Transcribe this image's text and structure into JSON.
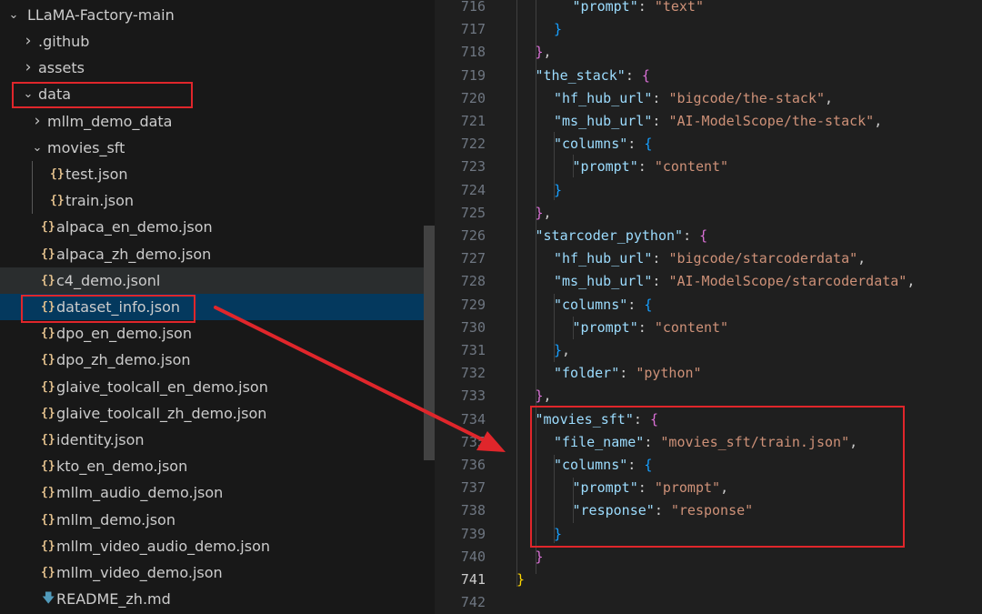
{
  "explorer": {
    "root": "LLaMA-Factory-main",
    "items": [
      {
        "label": ".github",
        "depth": 1,
        "type": "folder-collapsed"
      },
      {
        "label": "assets",
        "depth": 1,
        "type": "folder-collapsed"
      },
      {
        "label": "data",
        "depth": 1,
        "type": "folder-open"
      },
      {
        "label": "mllm_demo_data",
        "depth": 2,
        "type": "folder-collapsed"
      },
      {
        "label": "movies_sft",
        "depth": 2,
        "type": "folder-open"
      },
      {
        "label": "test.json",
        "depth": 3,
        "type": "json"
      },
      {
        "label": "train.json",
        "depth": 3,
        "type": "json"
      },
      {
        "label": "alpaca_en_demo.json",
        "depth": 2,
        "type": "json"
      },
      {
        "label": "alpaca_zh_demo.json",
        "depth": 2,
        "type": "json"
      },
      {
        "label": "c4_demo.jsonl",
        "depth": 2,
        "type": "json",
        "state": "hover"
      },
      {
        "label": "dataset_info.json",
        "depth": 2,
        "type": "json",
        "state": "selected"
      },
      {
        "label": "dpo_en_demo.json",
        "depth": 2,
        "type": "json"
      },
      {
        "label": "dpo_zh_demo.json",
        "depth": 2,
        "type": "json"
      },
      {
        "label": "glaive_toolcall_en_demo.json",
        "depth": 2,
        "type": "json"
      },
      {
        "label": "glaive_toolcall_zh_demo.json",
        "depth": 2,
        "type": "json"
      },
      {
        "label": "identity.json",
        "depth": 2,
        "type": "json"
      },
      {
        "label": "kto_en_demo.json",
        "depth": 2,
        "type": "json"
      },
      {
        "label": "mllm_audio_demo.json",
        "depth": 2,
        "type": "json"
      },
      {
        "label": "mllm_demo.json",
        "depth": 2,
        "type": "json"
      },
      {
        "label": "mllm_video_audio_demo.json",
        "depth": 2,
        "type": "json"
      },
      {
        "label": "mllm_video_demo.json",
        "depth": 2,
        "type": "json"
      },
      {
        "label": "README_zh.md",
        "depth": 2,
        "type": "markdown"
      }
    ],
    "icons": {
      "json": "{}",
      "folder_collapsed": "›",
      "folder_open": "⌄",
      "markdown": "🡇"
    }
  },
  "editor": {
    "current_line": 741,
    "lines": [
      {
        "n": 716,
        "ind": 3,
        "t": [
          [
            "k",
            "\"prompt\""
          ],
          [
            "p",
            ": "
          ],
          [
            "s",
            "\"text\""
          ]
        ]
      },
      {
        "n": 717,
        "ind": 2,
        "t": [
          [
            "b3",
            "}"
          ]
        ]
      },
      {
        "n": 718,
        "ind": 1,
        "t": [
          [
            "b2",
            "}"
          ],
          [
            "p",
            ","
          ]
        ]
      },
      {
        "n": 719,
        "ind": 1,
        "t": [
          [
            "k",
            "\"the_stack\""
          ],
          [
            "p",
            ": "
          ],
          [
            "b2",
            "{"
          ]
        ]
      },
      {
        "n": 720,
        "ind": 2,
        "t": [
          [
            "k",
            "\"hf_hub_url\""
          ],
          [
            "p",
            ": "
          ],
          [
            "s",
            "\"bigcode/the-stack\""
          ],
          [
            "p",
            ","
          ]
        ]
      },
      {
        "n": 721,
        "ind": 2,
        "t": [
          [
            "k",
            "\"ms_hub_url\""
          ],
          [
            "p",
            ": "
          ],
          [
            "s",
            "\"AI-ModelScope/the-stack\""
          ],
          [
            "p",
            ","
          ]
        ]
      },
      {
        "n": 722,
        "ind": 2,
        "t": [
          [
            "k",
            "\"columns\""
          ],
          [
            "p",
            ": "
          ],
          [
            "b3",
            "{"
          ]
        ]
      },
      {
        "n": 723,
        "ind": 3,
        "t": [
          [
            "k",
            "\"prompt\""
          ],
          [
            "p",
            ": "
          ],
          [
            "s",
            "\"content\""
          ]
        ]
      },
      {
        "n": 724,
        "ind": 2,
        "t": [
          [
            "b3",
            "}"
          ]
        ]
      },
      {
        "n": 725,
        "ind": 1,
        "t": [
          [
            "b2",
            "}"
          ],
          [
            "p",
            ","
          ]
        ]
      },
      {
        "n": 726,
        "ind": 1,
        "t": [
          [
            "k",
            "\"starcoder_python\""
          ],
          [
            "p",
            ": "
          ],
          [
            "b2",
            "{"
          ]
        ]
      },
      {
        "n": 727,
        "ind": 2,
        "t": [
          [
            "k",
            "\"hf_hub_url\""
          ],
          [
            "p",
            ": "
          ],
          [
            "s",
            "\"bigcode/starcoderdata\""
          ],
          [
            "p",
            ","
          ]
        ]
      },
      {
        "n": 728,
        "ind": 2,
        "t": [
          [
            "k",
            "\"ms_hub_url\""
          ],
          [
            "p",
            ": "
          ],
          [
            "s",
            "\"AI-ModelScope/starcoderdata\""
          ],
          [
            "p",
            ","
          ]
        ]
      },
      {
        "n": 729,
        "ind": 2,
        "t": [
          [
            "k",
            "\"columns\""
          ],
          [
            "p",
            ": "
          ],
          [
            "b3",
            "{"
          ]
        ]
      },
      {
        "n": 730,
        "ind": 3,
        "t": [
          [
            "k",
            "\"prompt\""
          ],
          [
            "p",
            ": "
          ],
          [
            "s",
            "\"content\""
          ]
        ]
      },
      {
        "n": 731,
        "ind": 2,
        "t": [
          [
            "b3",
            "}"
          ],
          [
            "p",
            ","
          ]
        ]
      },
      {
        "n": 732,
        "ind": 2,
        "t": [
          [
            "k",
            "\"folder\""
          ],
          [
            "p",
            ": "
          ],
          [
            "s",
            "\"python\""
          ]
        ]
      },
      {
        "n": 733,
        "ind": 1,
        "t": [
          [
            "b2",
            "}"
          ],
          [
            "p",
            ","
          ]
        ]
      },
      {
        "n": 734,
        "ind": 1,
        "t": [
          [
            "k",
            "\"movies_sft\""
          ],
          [
            "p",
            ": "
          ],
          [
            "b2",
            "{"
          ]
        ]
      },
      {
        "n": 735,
        "ind": 2,
        "t": [
          [
            "k",
            "\"file_name\""
          ],
          [
            "p",
            ": "
          ],
          [
            "s",
            "\"movies_sft/train.json\""
          ],
          [
            "p",
            ","
          ]
        ]
      },
      {
        "n": 736,
        "ind": 2,
        "t": [
          [
            "k",
            "\"columns\""
          ],
          [
            "p",
            ": "
          ],
          [
            "b3",
            "{"
          ]
        ]
      },
      {
        "n": 737,
        "ind": 3,
        "t": [
          [
            "k",
            "\"prompt\""
          ],
          [
            "p",
            ": "
          ],
          [
            "s",
            "\"prompt\""
          ],
          [
            "p",
            ","
          ]
        ]
      },
      {
        "n": 738,
        "ind": 3,
        "t": [
          [
            "k",
            "\"response\""
          ],
          [
            "p",
            ": "
          ],
          [
            "s",
            "\"response\""
          ]
        ]
      },
      {
        "n": 739,
        "ind": 2,
        "t": [
          [
            "b3",
            "}"
          ]
        ]
      },
      {
        "n": 740,
        "ind": 1,
        "t": [
          [
            "b2",
            "}"
          ]
        ]
      },
      {
        "n": 741,
        "ind": 0,
        "t": [
          [
            "b1",
            "}"
          ]
        ]
      },
      {
        "n": 742,
        "ind": 0,
        "t": []
      }
    ]
  },
  "annotations": {
    "box_color": "#e0262b",
    "arrow_color": "#e0262b"
  }
}
